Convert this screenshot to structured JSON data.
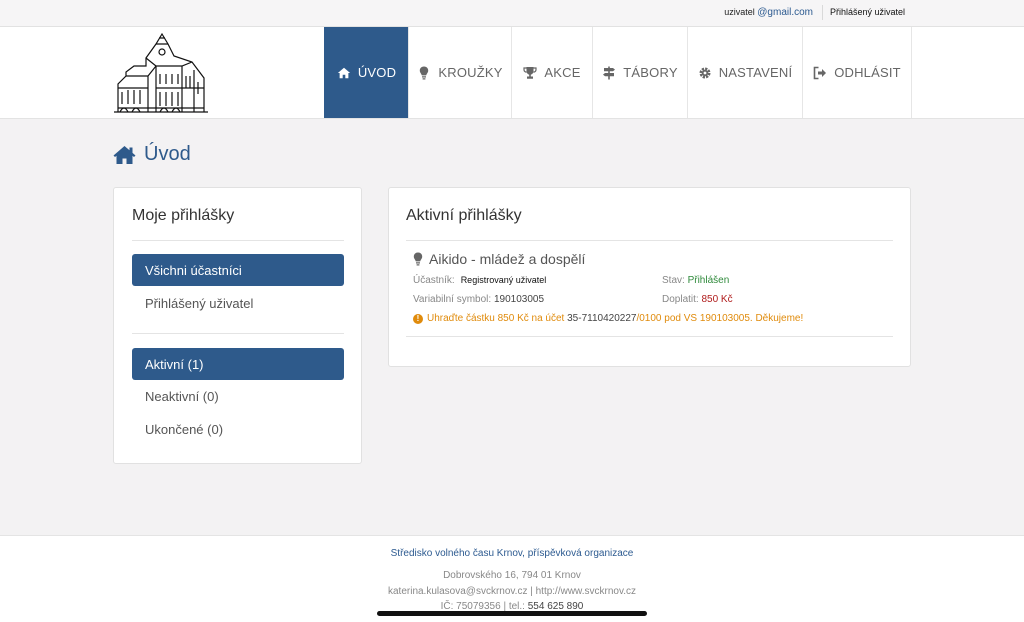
{
  "topbar": {
    "user_prefix": "uzivatel ",
    "user_domain": "@gmail.com",
    "logged_label": "Přihlášený uživatel"
  },
  "nav": [
    {
      "label": "ÚVOD",
      "icon": "home-icon",
      "active": true
    },
    {
      "label": "KROUŽKY",
      "icon": "lightbulb-icon",
      "active": false
    },
    {
      "label": "AKCE",
      "icon": "trophy-icon",
      "active": false
    },
    {
      "label": "TÁBORY",
      "icon": "signpost-icon",
      "active": false
    },
    {
      "label": "NASTAVENÍ",
      "icon": "gear-icon",
      "active": false
    },
    {
      "label": "ODHLÁSIT",
      "icon": "logout-icon",
      "active": false
    }
  ],
  "page_title": "Úvod",
  "my_registrations": {
    "title": "Moje přihlášky",
    "participants": [
      {
        "label": "Všichni účastníci",
        "active": true
      },
      {
        "label": "Přihlášený uživatel",
        "active": false
      }
    ],
    "statuses": [
      {
        "label": "Aktivní (1)",
        "active": true
      },
      {
        "label": "Neaktivní (0)",
        "active": false
      },
      {
        "label": "Ukončené (0)",
        "active": false
      }
    ]
  },
  "active_registrations": {
    "title": "Aktivní přihlášky",
    "course": "Aikido - mládež a dospělí",
    "participant_label": "Účastník:",
    "participant_value": "Registrovaný uživatel",
    "status_label": "Stav:",
    "status_value": "Přihlášen",
    "vs_label": "Variabilní symbol:",
    "vs_value": "190103005",
    "due_label": "Doplatit:",
    "due_value": "850 Kč",
    "payment_before": "Uhraďte částku 850 Kč na účet ",
    "payment_account": "35-7110420227",
    "payment_after": "/0100 pod VS 190103005. Děkujeme!"
  },
  "footer": {
    "org": "Středisko volného času Krnov, příspěvková organizace",
    "address": "Dobrovského 16, 794 01 Krnov",
    "contact": "katerina.kulasova@svckrnov.cz | http://www.svckrnov.cz",
    "ic_prefix": "IČ: 75079356 | tel.: ",
    "phone": "554 625 890"
  },
  "colors": {
    "primary": "#2e5a8b",
    "warning": "#e08b0c",
    "success": "#2f8a3b",
    "danger": "#b01c1c"
  }
}
